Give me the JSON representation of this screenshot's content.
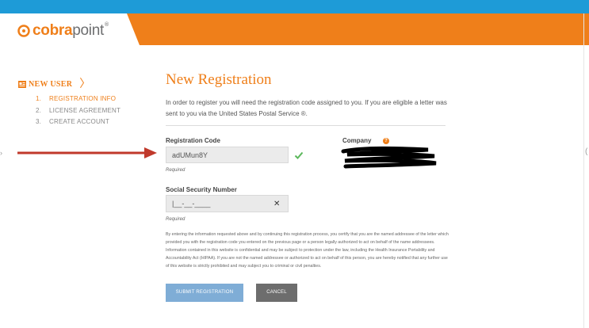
{
  "header": {
    "brand_part1": "cobra",
    "brand_part2": "point",
    "trademark": "®"
  },
  "sidebar": {
    "section_title": "NEW USER",
    "steps": [
      {
        "num": "1.",
        "label": "REGISTRATION INFO",
        "active": true
      },
      {
        "num": "2.",
        "label": "LICENSE AGREEMENT",
        "active": false
      },
      {
        "num": "3.",
        "label": "CREATE ACCOUNT",
        "active": false
      }
    ]
  },
  "main": {
    "title": "New Registration",
    "intro": "In order to register you will need the registration code assigned to you. If you are eligible a letter was sent to you via the United States Postal Service ®.",
    "registration_code": {
      "label": "Registration Code",
      "value": "adUMun8Y",
      "required": "Required"
    },
    "company": {
      "label": "Company",
      "help": "?"
    },
    "ssn": {
      "label": "Social Security Number",
      "value": "|__-__-____",
      "required": "Required",
      "clear": "✕"
    },
    "legal": "By entering the information requested above and by continuing this registration process, you certify that you are the named addressee of the letter which provided you with the registration code you entered on the previous page or a person legally authorized to act on behalf of the name addressees. Information contained in this website is confidential and may be subject to protection under the law, including the Health Insurance Portability and Accountability Act (HIPAA). If you are not the named addressee or authorized to act on behalf of this person, you are hereby notified that any further use of this website is strictly prohibited and may subject you to criminal or civil penalties.",
    "buttons": {
      "submit": "SUBMIT REGISTRATION",
      "cancel": "CANCEL"
    }
  },
  "colors": {
    "accent": "#ef7f1a",
    "topbar": "#1e9bd7",
    "submit": "#7fadd6",
    "cancel": "#6d6d6d",
    "annotation_arrow": "#c0392b"
  }
}
